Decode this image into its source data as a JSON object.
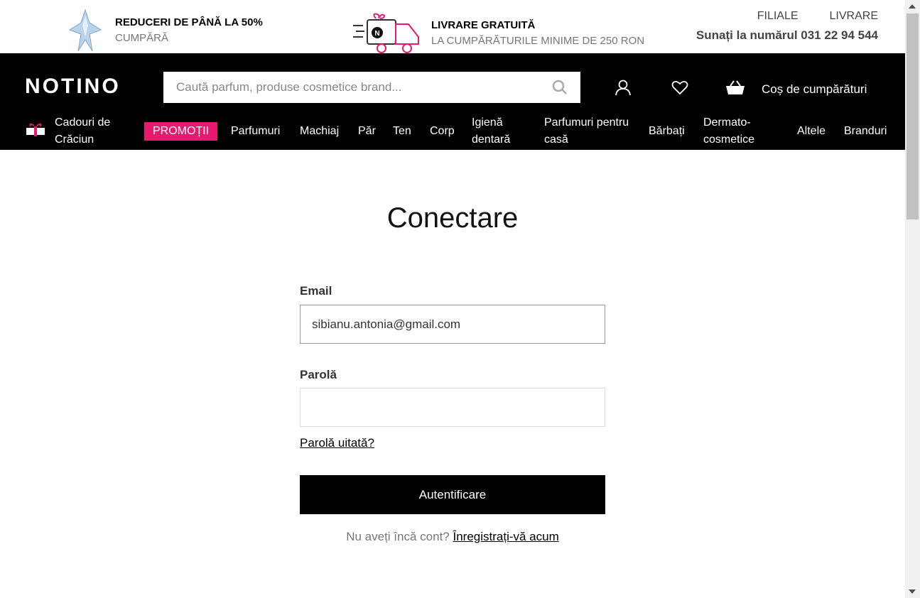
{
  "topbar": {
    "promo1": {
      "title": "REDUCERI DE PÂNĂ LA 50%",
      "sub": "CUMPĂRĂ"
    },
    "promo2": {
      "title": "LIVRARE GRATUITĂ",
      "sub": "LA CUMPĂRĂTURILE MINIME DE 250 RON"
    },
    "links": [
      "FILIALE",
      "LIVRARE"
    ],
    "phone": "Sunați la numărul 031 22 94 544"
  },
  "header": {
    "logo": "NOTINO",
    "search_placeholder": "Caută parfum, produse cosmetice brand...",
    "cart_label": "Coș de cumpărături"
  },
  "nav": {
    "gifts": "Cadouri de Crăciun",
    "promo": "PROMOȚII",
    "items": [
      "Parfumuri",
      "Machiaj",
      "Păr",
      "Ten",
      "Corp",
      "Igienă dentară",
      "Parfumuri pentru casă",
      "Bărbați",
      "Dermato-cosmetice",
      "Altele",
      "Branduri"
    ]
  },
  "login": {
    "title": "Conectare",
    "email_label": "Email",
    "email_value": "sibianu.antonia@gmail.com",
    "password_label": "Parolă",
    "password_value": "",
    "forgot": "Parolă uitată?",
    "submit": "Autentificare",
    "no_account": "Nu aveți încă cont?",
    "register": "Înregistrați-vă acum"
  },
  "colors": {
    "promo_pink": "#e8196f",
    "header_bg": "#000000"
  }
}
